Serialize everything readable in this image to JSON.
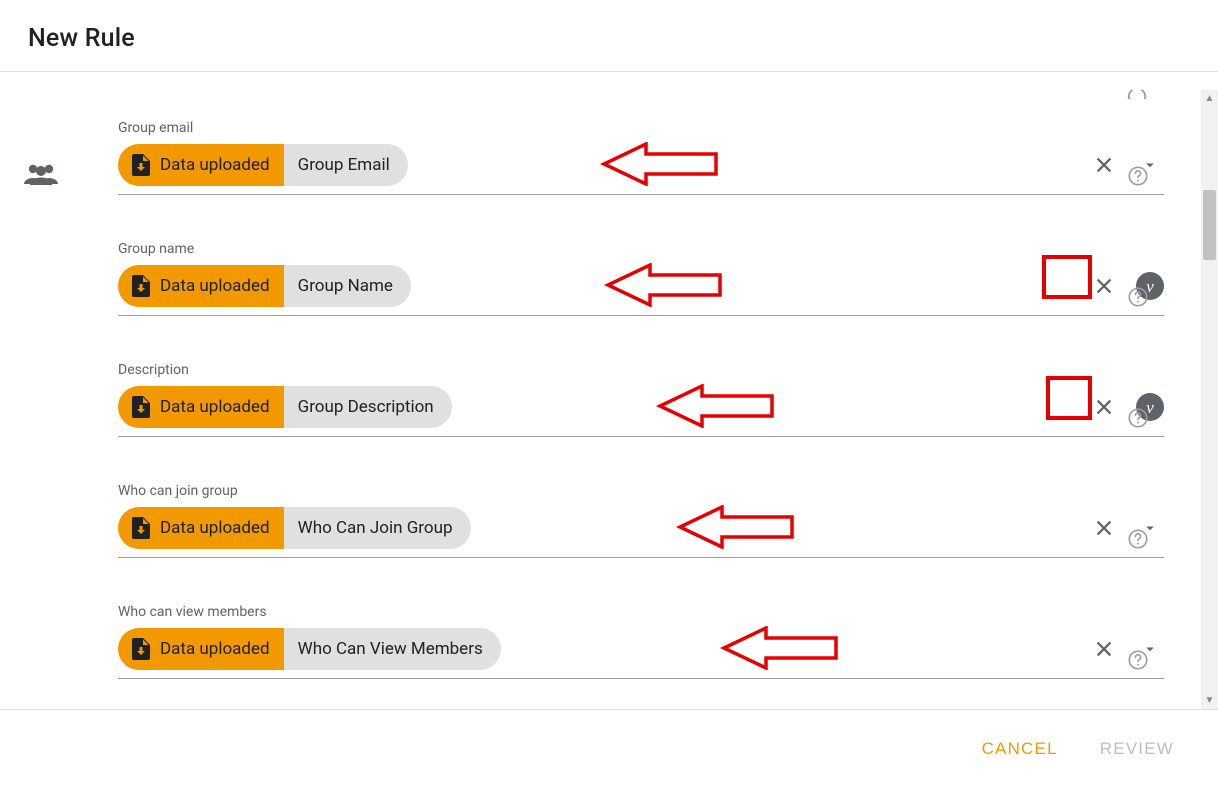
{
  "header": {
    "title": "New Rule"
  },
  "chip_source_label": "Data uploaded",
  "fields": [
    {
      "key": "group_email",
      "label": "Group email",
      "value": "Group Email",
      "right_control": "dropdown"
    },
    {
      "key": "group_name",
      "label": "Group name",
      "value": "Group Name",
      "right_control": "variable"
    },
    {
      "key": "description",
      "label": "Description",
      "value": "Group Description",
      "right_control": "variable"
    },
    {
      "key": "who_can_join",
      "label": "Who can join group",
      "value": "Who Can Join Group",
      "right_control": "dropdown"
    },
    {
      "key": "who_can_view_members",
      "label": "Who can view members",
      "value": "Who Can View Members",
      "right_control": "dropdown"
    }
  ],
  "variable_glyph": "v",
  "footer": {
    "cancel": "CANCEL",
    "review": "REVIEW"
  },
  "colors": {
    "accent": "#f29900",
    "annotation": "#e60000"
  }
}
